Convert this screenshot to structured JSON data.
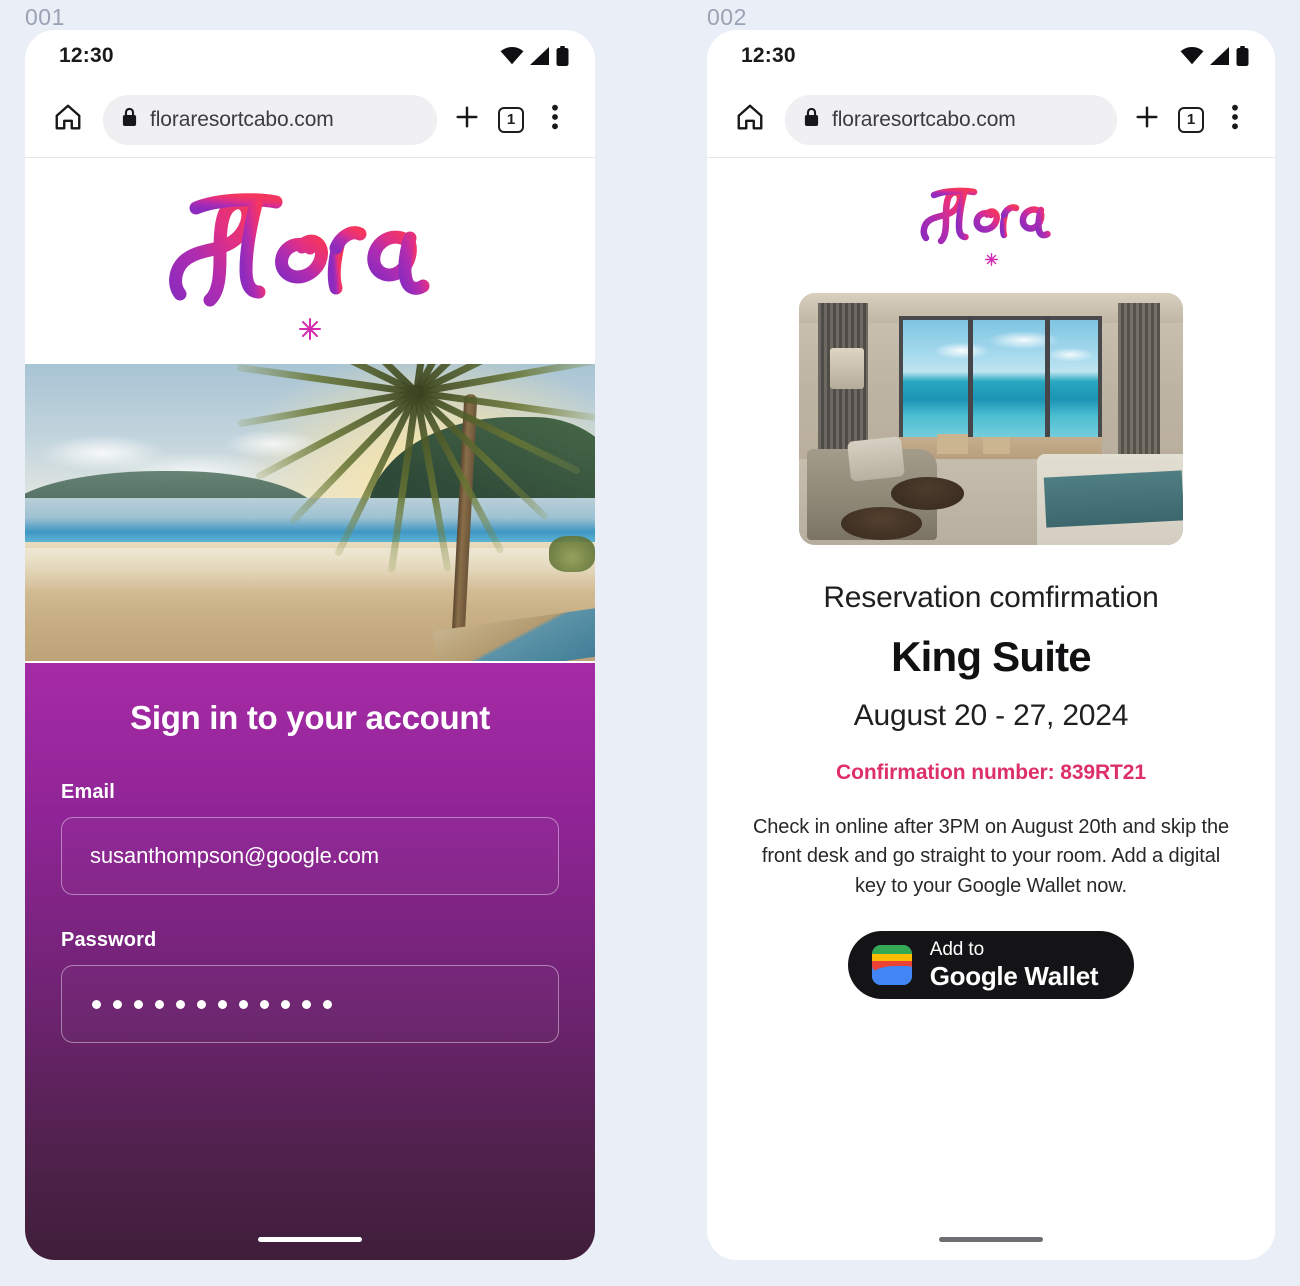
{
  "page": {
    "background_color": "#eaeef7"
  },
  "frames": [
    {
      "label": "001"
    },
    {
      "label": "002"
    }
  ],
  "status_bar": {
    "time": "12:30",
    "icons": [
      "wifi-icon",
      "cellular-signal-icon",
      "battery-icon"
    ]
  },
  "browser": {
    "home_icon": "home-icon",
    "lock_icon": "lock-icon",
    "url": "floraresortcabo.com",
    "new_tab_icon": "plus-icon",
    "tab_count": "1",
    "menu_icon": "overflow-menu-icon"
  },
  "brand": {
    "wordmark": "Flora",
    "mark_gradient_start": "#8c2bbd",
    "mark_gradient_end": "#f0326a",
    "flower_icon": "asterisk-flower-icon"
  },
  "screen_001": {
    "hero_image_alt": "beach-sunset-palm-tree-photo",
    "signin": {
      "title": "Sign in to your account",
      "email": {
        "label": "Email",
        "value": "susanthompson@google.com",
        "placeholder": "Email"
      },
      "password": {
        "label": "Password",
        "value": "••••••••••••",
        "masked_dot_count": 12,
        "placeholder": "Password"
      },
      "panel_gradient_start": "#a62ba6",
      "panel_gradient_end": "#3f1e3a"
    }
  },
  "screen_002": {
    "room_image_alt": "hotel-suite-ocean-view-photo",
    "kicker": "Reservation comfirmation",
    "room_name": "King Suite",
    "dates": "August 20 - 27, 2024",
    "confirmation_line": "Confirmation number: 839RT21",
    "confirmation_color": "#dd3069",
    "body": "Check in online after 3PM on August 20th and skip the front desk and go straight to your room. Add a digital key to your Google Wallet now.",
    "wallet_button": {
      "small_label": "Add to",
      "big_label": "Google Wallet",
      "icon": "google-wallet-icon",
      "background_color": "#141417"
    }
  }
}
